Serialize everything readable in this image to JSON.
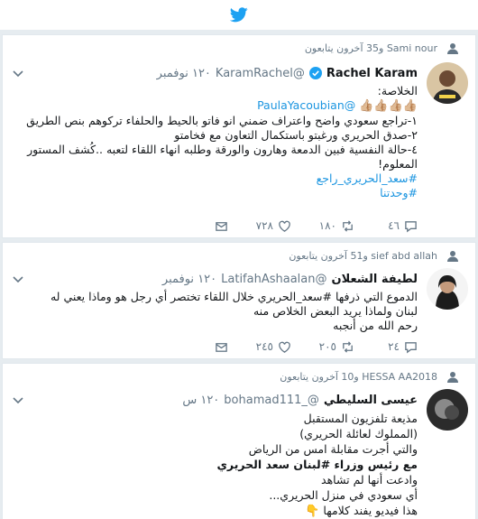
{
  "app": {
    "logo": "twitter-bird-icon",
    "brand_color": "#1da1f2"
  },
  "tweets": [
    {
      "retweet_line": "Sami nour و35 آخرون يتابعون",
      "name": "Rachel Karam",
      "verified": true,
      "handle": "@KaramRachel",
      "time": "١٢٠ نوفمبر",
      "lines": [
        "الخلاصة:",
        "@PaulaYacoubian",
        "١-تراجع سعودي واضح واعتراف ضمني انو فاتو بالحيط والحلفاء تركوهم بنص الطريق",
        "٢-صدق الحريري ورغبتو باستكمال التعاون مع فخامتو",
        "٤-حالة النفسية فبين الدمعة وهارون والورقة وطلبه انهاء اللقاء لتعبه ..كُشف المستور",
        "المعلوم!",
        "#سعد_الحريري_راجع",
        "#وحدتنا"
      ],
      "emojis": "👍🏼👍🏼👍🏼👍🏼",
      "actions": {
        "replies": "٤٦",
        "retweets": "١٨٠",
        "likes": "٧٢٨"
      }
    },
    {
      "retweet_line": "sief abd allah و51 آخرون يتابعون",
      "name": "لطيفة الشعلان",
      "verified": false,
      "handle": "@LatifahAshaalan",
      "time": "١٢٠ نوفمبر",
      "lines": [
        "الدموع التي ذرفها #سعد_الحريري خلال اللقاء تختصر أي رجل هو وماذا يعني له",
        "لبنان ولماذا يريد البعض الخلاص منه",
        "رحم الله من أنجبه"
      ],
      "actions": {
        "replies": "٢٤",
        "retweets": "٢٠٥",
        "likes": "٢٤٥"
      }
    },
    {
      "retweet_line": "HESSA AA2018 و10 آخرون يتابعون",
      "name": "عيسى السليطي",
      "verified": false,
      "handle": "@_bohamad111",
      "time": "١٢٠ س",
      "lines": [
        "مذيعة تلفزيون المستقبل",
        "(المملوك لعائلة الحريري)",
        "والتي أجرت مقابلة امس من الرياض",
        "مع رئيس وزراء #لبنان سعد الحريري",
        "وادعت أنها لم تشاهد",
        "أي سعودي في منزل الحريري...",
        "هذا فيديو يفند كلامها"
      ]
    }
  ]
}
